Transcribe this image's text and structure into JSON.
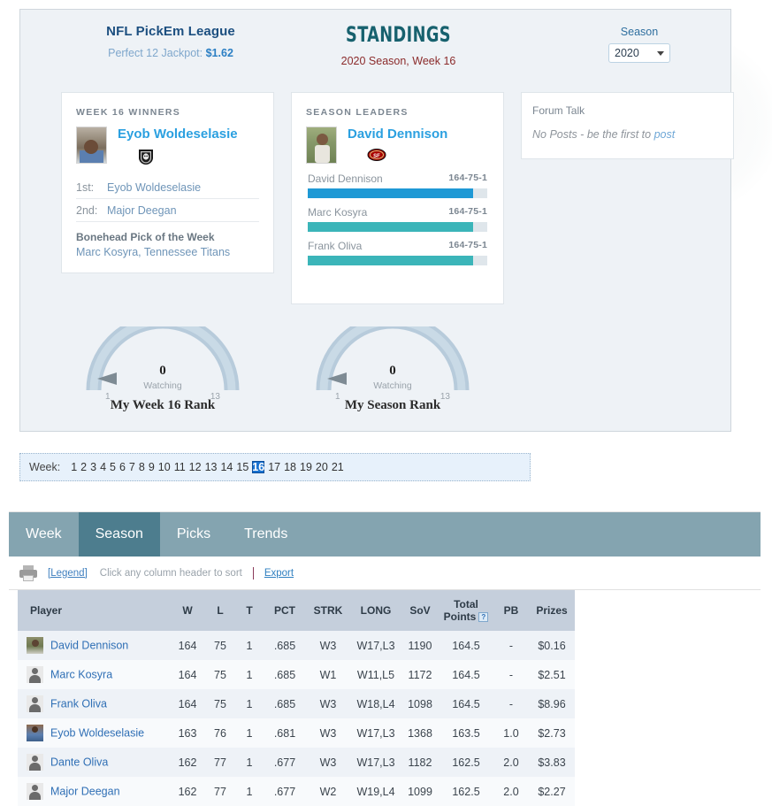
{
  "header": {
    "league_name": "NFL PickEm League",
    "jackpot_label": "Perfect 12 Jackpot:",
    "jackpot_value": "$1.62",
    "title": "STANDINGS",
    "subtitle": "2020 Season, Week 16",
    "season_label": "Season",
    "season_value": "2020",
    "caret_icon": "chevron-down-icon"
  },
  "winners_card": {
    "title": "WEEK 16 WINNERS",
    "feature_name": "Eyob Woldeselasie",
    "feature_team": "Las Vegas Raiders",
    "places": [
      {
        "rank": "1st:",
        "name": "Eyob Woldeselasie"
      },
      {
        "rank": "2nd:",
        "name": "Major Deegan"
      }
    ],
    "bonehead_title": "Bonehead Pick of the Week",
    "bonehead_text": "Marc Kosyra, Tennessee Titans"
  },
  "leaders_card": {
    "title": "SEASON LEADERS",
    "feature_name": "David Dennison",
    "feature_team": "San Francisco 49ers",
    "bars": [
      {
        "name": "David Dennison",
        "record": "164-75-1",
        "pct": 92,
        "color": "#1f99d5"
      },
      {
        "name": "Marc Kosyra",
        "record": "164-75-1",
        "pct": 92,
        "color": "#3bb5b9"
      },
      {
        "name": "Frank Oliva",
        "record": "164-75-1",
        "pct": 92,
        "color": "#3bb5b9"
      }
    ]
  },
  "forum_card": {
    "title": "Forum Talk",
    "empty_text": "No Posts - be the first to",
    "link_text": "post"
  },
  "gauges": [
    {
      "name": "week",
      "value": "0",
      "sub": "Watching",
      "min": "1",
      "max": "13",
      "title": "My Week 16 Rank"
    },
    {
      "name": "season",
      "value": "0",
      "sub": "Watching",
      "min": "1",
      "max": "13",
      "title": "My Season Rank"
    }
  ],
  "week_strip": {
    "label": "Week:",
    "weeks": [
      "1",
      "2",
      "3",
      "4",
      "5",
      "6",
      "7",
      "8",
      "9",
      "10",
      "11",
      "12",
      "13",
      "14",
      "15",
      "16",
      "17",
      "18",
      "19",
      "20",
      "21"
    ],
    "active": "16"
  },
  "tabs": [
    {
      "label": "Week",
      "active": false
    },
    {
      "label": "Season",
      "active": true
    },
    {
      "label": "Picks",
      "active": false
    },
    {
      "label": "Trends",
      "active": false
    }
  ],
  "toolbar": {
    "print_icon": "printer-icon",
    "legend_label": "[Legend]",
    "hint": "Click any column header to sort",
    "export_label": "Export"
  },
  "table": {
    "columns": [
      "Player",
      "W",
      "L",
      "T",
      "PCT",
      "STRK",
      "LONG",
      "SoV",
      "Total Points",
      "PB",
      "Prizes"
    ],
    "help_icon_column": "Total Points",
    "rows": [
      {
        "avatar": "photo1",
        "player": "David Dennison",
        "W": "164",
        "L": "75",
        "T": "1",
        "PCT": ".685",
        "STRK": "W3",
        "LONG": "W17,L3",
        "SoV": "1190",
        "TotalPoints": "164.5",
        "PB": "-",
        "Prizes": "$0.16"
      },
      {
        "avatar": "silh",
        "player": "Marc Kosyra",
        "W": "164",
        "L": "75",
        "T": "1",
        "PCT": ".685",
        "STRK": "W1",
        "LONG": "W11,L5",
        "SoV": "1172",
        "TotalPoints": "164.5",
        "PB": "-",
        "Prizes": "$2.51"
      },
      {
        "avatar": "silh",
        "player": "Frank Oliva",
        "W": "164",
        "L": "75",
        "T": "1",
        "PCT": ".685",
        "STRK": "W3",
        "LONG": "W18,L4",
        "SoV": "1098",
        "TotalPoints": "164.5",
        "PB": "-",
        "Prizes": "$8.96"
      },
      {
        "avatar": "photo2",
        "player": "Eyob Woldeselasie",
        "W": "163",
        "L": "76",
        "T": "1",
        "PCT": ".681",
        "STRK": "W3",
        "LONG": "W17,L3",
        "SoV": "1368",
        "TotalPoints": "163.5",
        "PB": "1.0",
        "Prizes": "$2.73"
      },
      {
        "avatar": "silh",
        "player": "Dante Oliva",
        "W": "162",
        "L": "77",
        "T": "1",
        "PCT": ".677",
        "STRK": "W3",
        "LONG": "W17,L3",
        "SoV": "1182",
        "TotalPoints": "162.5",
        "PB": "2.0",
        "Prizes": "$3.83"
      },
      {
        "avatar": "silh",
        "player": "Major Deegan",
        "W": "162",
        "L": "77",
        "T": "1",
        "PCT": ".677",
        "STRK": "W2",
        "LONG": "W19,L4",
        "SoV": "1099",
        "TotalPoints": "162.5",
        "PB": "2.0",
        "Prizes": "$2.27"
      }
    ]
  },
  "colors": {
    "panel_bg": "#eef2f6",
    "accent_teal": "#17616e",
    "tab_bar": "#84a4b0",
    "tab_active": "#4d7d8e",
    "week_active": "#1a73d2",
    "link": "#2f6fb5"
  }
}
